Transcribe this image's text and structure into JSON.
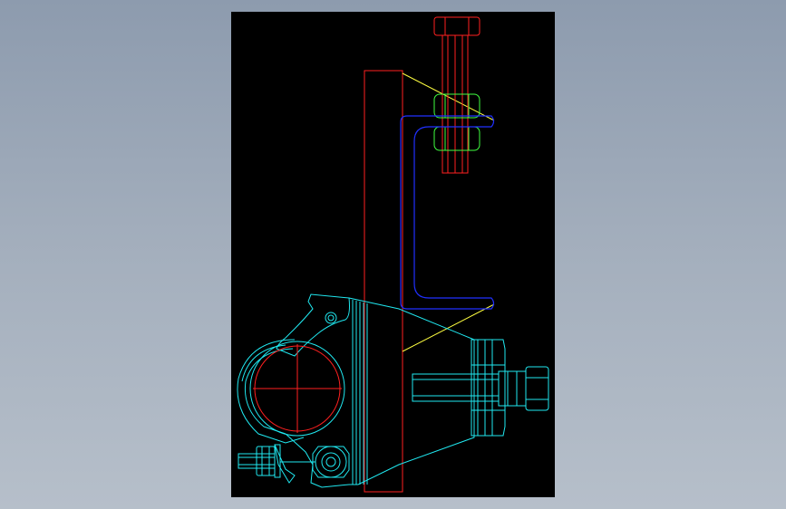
{
  "drawing": {
    "background": "#000000",
    "layer_colors": {
      "beam": "#ff2020",
      "bracket": "#2030ff",
      "bolt": "#ff2020",
      "nut": "#40ff40",
      "clamp": "#20e8f0",
      "pipe": "#ff2020",
      "guide": "#ffff40"
    }
  }
}
